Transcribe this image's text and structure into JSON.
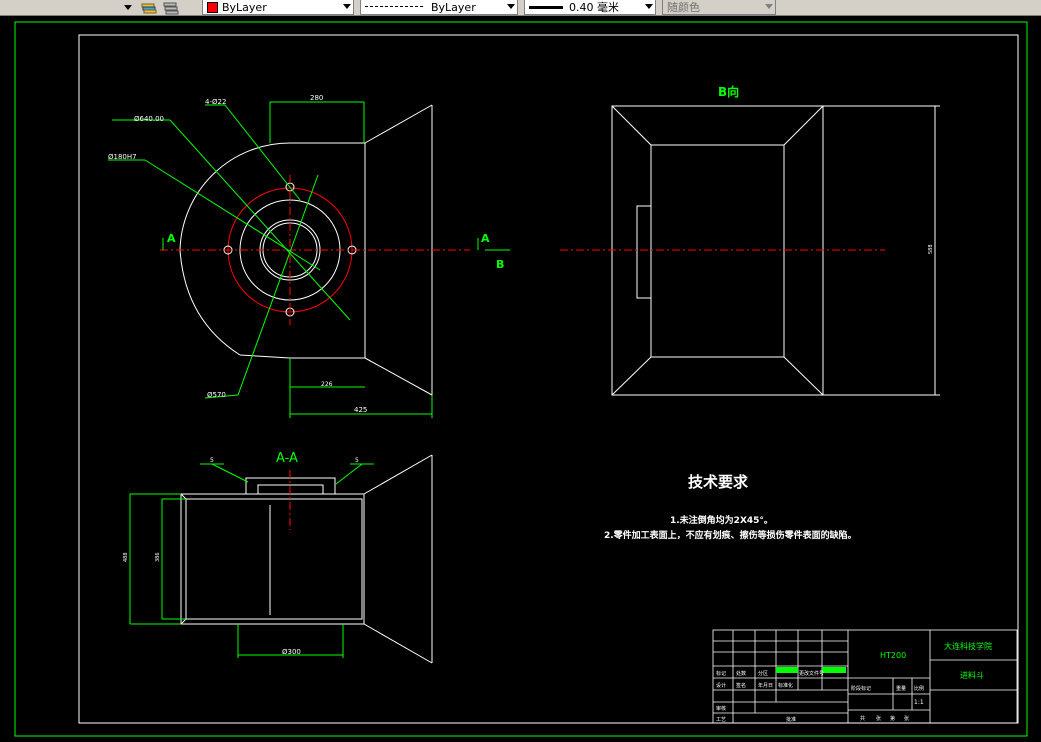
{
  "toolbar": {
    "color_value": "ByLayer",
    "linetype_value": "ByLayer",
    "lineweight_value": "0.40 毫米",
    "plotstyle_value": "随颜色",
    "colors": {
      "layer_swatch": "#ff0000"
    }
  },
  "drawing": {
    "dims": {
      "d640": "Ø640.00",
      "holes": "4-Ø22",
      "d180": "Ø180H7",
      "w280": "280",
      "d570": "Ø570",
      "w226": "226",
      "w425": "425",
      "d300": "Ø300",
      "h1": "488",
      "h2": "386",
      "view_h": "588",
      "weld1": "5",
      "weld2": "5"
    },
    "section_letter_left": "A",
    "section_letter_right": "A",
    "arrow_letter": "B",
    "view_b_title": "B向",
    "section_title": "A-A",
    "tech_req": {
      "title": "技术要求",
      "item1": "1.未注倒角均为2X45°。",
      "item2": "2.零件加工表面上，不应有划痕、擦伤等损伤零件表面的缺陷。"
    },
    "title_block": {
      "material": "HT200",
      "school": "大连科技学院",
      "part_name": "进料斗",
      "scale": "1:1",
      "labels": {
        "biaoji": "标记",
        "chushu": "处数",
        "fenqu": "分区",
        "gengai": "更改文件号",
        "qianming": "签名",
        "riqi": "年月日",
        "sheji": "设计",
        "biaozhunhua": "标准化",
        "jieduan": "阶段标记",
        "zhongliang": "重量",
        "bili": "比例",
        "shenhe": "审核",
        "gongyi": "工艺",
        "pizhun": "批准",
        "gong": "共",
        "zhang1": "张",
        "di": "第",
        "zhang2": "张"
      }
    }
  }
}
